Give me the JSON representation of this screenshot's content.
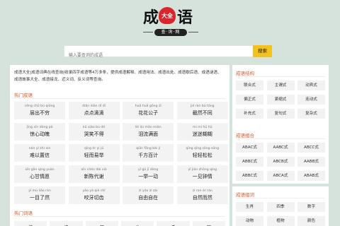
{
  "logo": {
    "char1": "成",
    "char2": "大全",
    "char3": "语",
    "sub": "查·询·网"
  },
  "search": {
    "placeholder": "输入要查询的成语",
    "button": "搜索"
  },
  "intro": "成语大全|成语词典在线查询|收录四字成语等4万多条，提供成语解释、成语用法、成语出处、成语歇后语、成语谜语、成语故事大全、成语接龙、近义词、反义词等查询。",
  "hot_title": "热门成语",
  "idioms": [
    {
      "py": "céng chū bù qióng",
      "hz": "层出不穷"
    },
    {
      "py": "diǎn diǎn dī dī",
      "hz": "点点滴滴"
    },
    {
      "py": "huā huā gōng zǐ",
      "hz": "花花公子"
    },
    {
      "py": "jié rán bù tóng",
      "hz": "截然不同"
    },
    {
      "py": "jīng xīn dòng pò",
      "hz": "惊心动魄"
    },
    {
      "py": "kū xiào bù dé",
      "hz": "哭笑不得"
    },
    {
      "py": "lèi liú mǎn miàn",
      "hz": "泪流满面"
    },
    {
      "py": "mí mí hū hū",
      "hz": "迷迷糊糊"
    },
    {
      "py": "nán yǐ zhì xìn",
      "hz": "难以置信"
    },
    {
      "py": "qīng ér yì jǔ",
      "hz": "轻而易举"
    },
    {
      "py": "qiān fāng bǎi jì",
      "hz": "千方百计"
    },
    {
      "py": "qīng qīng sōng sōng",
      "hz": "轻轻松松"
    },
    {
      "py": "xīn gān qíng yuàn",
      "hz": "心甘情愿"
    },
    {
      "py": "xīn chén dài xiè",
      "hz": "新陈代谢"
    },
    {
      "py": "yī gǔ jī dòng",
      "hz": "一举一动"
    },
    {
      "py": "yī jiàn zhōng qíng",
      "hz": "一见钟情"
    },
    {
      "py": "yī mù liǎo rán",
      "hz": "一目了然"
    },
    {
      "py": "yǎo yá qiè chǐ",
      "hz": "咬牙切齿"
    },
    {
      "py": "zì yóu zì zài",
      "hz": "自由自在"
    },
    {
      "py": "zì ran ér rán",
      "hz": "自然而然"
    }
  ],
  "hot2_title": "热门词语",
  "chars": [
    "埃",
    "诀",
    "祖",
    "乡",
    "希",
    "厉"
  ],
  "side1": {
    "title": "成语结构",
    "tags": [
      "联合式",
      "主谓式",
      "动宾式",
      "偏正式",
      "紧缩式",
      "连动式",
      "补充式",
      "复句式",
      "复杂式"
    ]
  },
  "side2": {
    "title": "成语组合",
    "tags": [
      "ABAC式",
      "AABC式",
      "ABCC式",
      "ABBC式",
      "ABCB式",
      "AABB式",
      "ABBC式",
      "ABCA式",
      "ABAB式"
    ]
  },
  "side3": {
    "title": "成语组词",
    "tags": [
      "生肖",
      "四季",
      "数字",
      "动物",
      "植物",
      "颜色"
    ]
  }
}
